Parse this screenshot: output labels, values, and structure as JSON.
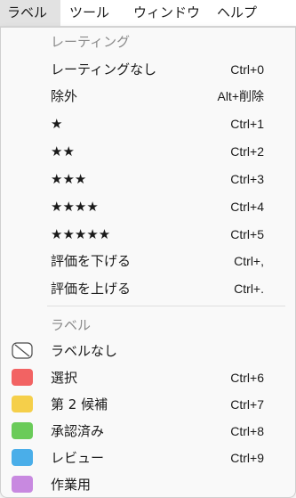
{
  "menubar": {
    "items": [
      "ラベル",
      "ツール",
      "ウィンドウ",
      "ヘルプ"
    ]
  },
  "rating_section": {
    "header": "レーティング",
    "items": [
      {
        "label": "レーティングなし",
        "shortcut": "Ctrl+0"
      },
      {
        "label": "除外",
        "shortcut": "Alt+削除"
      },
      {
        "label": "★",
        "shortcut": "Ctrl+1"
      },
      {
        "label": "★★",
        "shortcut": "Ctrl+2"
      },
      {
        "label": "★★★",
        "shortcut": "Ctrl+3"
      },
      {
        "label": "★★★★",
        "shortcut": "Ctrl+4"
      },
      {
        "label": "★★★★★",
        "shortcut": "Ctrl+5"
      },
      {
        "label": "評価を下げる",
        "shortcut": "Ctrl+,"
      },
      {
        "label": "評価を上げる",
        "shortcut": "Ctrl+."
      }
    ]
  },
  "label_section": {
    "header": "ラベル",
    "items": [
      {
        "label": "ラベルなし",
        "shortcut": "",
        "icon": "no-label-icon",
        "color": ""
      },
      {
        "label": "選択",
        "shortcut": "Ctrl+6",
        "icon": "red-label-swatch",
        "color": "#f26363"
      },
      {
        "label": "第 2 候補",
        "shortcut": "Ctrl+7",
        "icon": "yellow-label-swatch",
        "color": "#f5cf4a"
      },
      {
        "label": "承認済み",
        "shortcut": "Ctrl+8",
        "icon": "green-label-swatch",
        "color": "#6acb59"
      },
      {
        "label": "レビュー",
        "shortcut": "Ctrl+9",
        "icon": "blue-label-swatch",
        "color": "#4aaee9"
      },
      {
        "label": "作業用",
        "shortcut": "",
        "icon": "purple-label-swatch",
        "color": "#c889e0"
      }
    ]
  }
}
